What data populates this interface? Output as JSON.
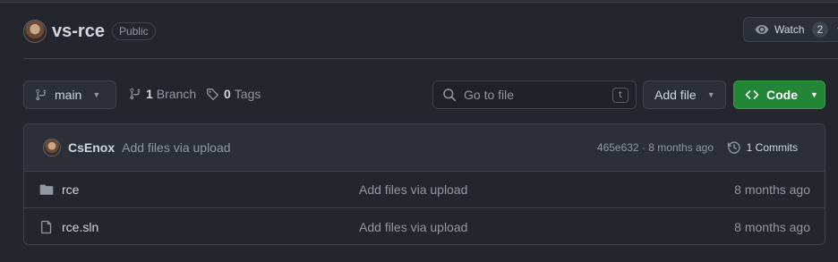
{
  "repo": {
    "name": "vs-rce",
    "visibility": "Public"
  },
  "watch": {
    "label": "Watch",
    "count": "2",
    "icon": "eye-icon"
  },
  "toolbar": {
    "branch": "main",
    "branch_count": "1",
    "branch_label": "Branch",
    "tag_count": "0",
    "tag_label": "Tags",
    "search_placeholder": "Go to file",
    "search_shortcut": "t",
    "add_file_label": "Add file",
    "code_label": "Code"
  },
  "latest_commit": {
    "author": "CsEnox",
    "message": "Add files via upload",
    "hash_time": "465e632 · 8 months ago",
    "commits_label": "1 Commits"
  },
  "files": [
    {
      "name": "rce",
      "type": "folder",
      "icon": "folder-icon",
      "message": "Add files via upload",
      "date": "8 months ago"
    },
    {
      "name": "rce.sln",
      "type": "file",
      "icon": "file-icon",
      "message": "Add files via upload",
      "date": "8 months ago"
    }
  ],
  "colors": {
    "background": "#23262d",
    "primary_button": "#238636",
    "muted_text": "#9198a1",
    "border": "#3d444d"
  }
}
